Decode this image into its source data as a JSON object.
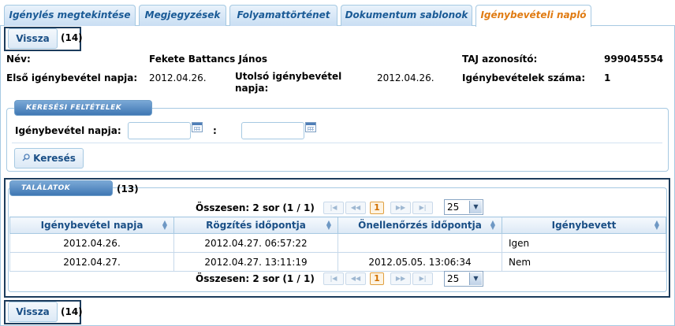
{
  "tabs": [
    {
      "label": "Igénylés megtekintése"
    },
    {
      "label": "Megjegyzések"
    },
    {
      "label": "Folyamattörténet"
    },
    {
      "label": "Dokumentum sablonok"
    },
    {
      "label": "Igénybevételi napló"
    }
  ],
  "top_back": {
    "label": "Vissza",
    "badge": "(14)"
  },
  "bottom_back": {
    "label": "Vissza",
    "badge": "(14)"
  },
  "info": {
    "name_label": "Név:",
    "name_value": "Fekete Battancs János",
    "taj_label": "TAJ azonosító:",
    "taj_value": "999045554",
    "first_label": "Első igénybevétel napja:",
    "first_value": "2012.04.26.",
    "last_label_1": "Utolsó igénybevétel",
    "last_label_2": "napja:",
    "last_value": "2012.04.26.",
    "count_label": "Igénybevételek száma:",
    "count_value": "1"
  },
  "search": {
    "legend": "Keresési feltételek",
    "date_label": "Igénybevétel napja:",
    "from_value": "",
    "to_value": "",
    "range_separator": ":",
    "button_label": "Keresés"
  },
  "results": {
    "legend": "Találatok",
    "badge": "(13)",
    "summary": "Összesen: 2 sor (1 / 1)",
    "current_page": "1",
    "page_size": "25",
    "columns": [
      "Igénybevétel napja",
      "Rögzítés időpontja",
      "Önellenőrzés időpontja",
      "Igénybevett"
    ],
    "rows": [
      [
        "2012.04.26.",
        "2012.04.27. 06:57:22",
        "",
        "Igen"
      ],
      [
        "2012.04.27.",
        "2012.04.27. 13:11:19",
        "2012.05.05. 13:06:34",
        "Nem"
      ]
    ]
  },
  "colors": {
    "accent": "#e07b12",
    "tab_text": "#1a5a96",
    "border": "#a6c9e2",
    "highlight": "#1c3c5c"
  }
}
